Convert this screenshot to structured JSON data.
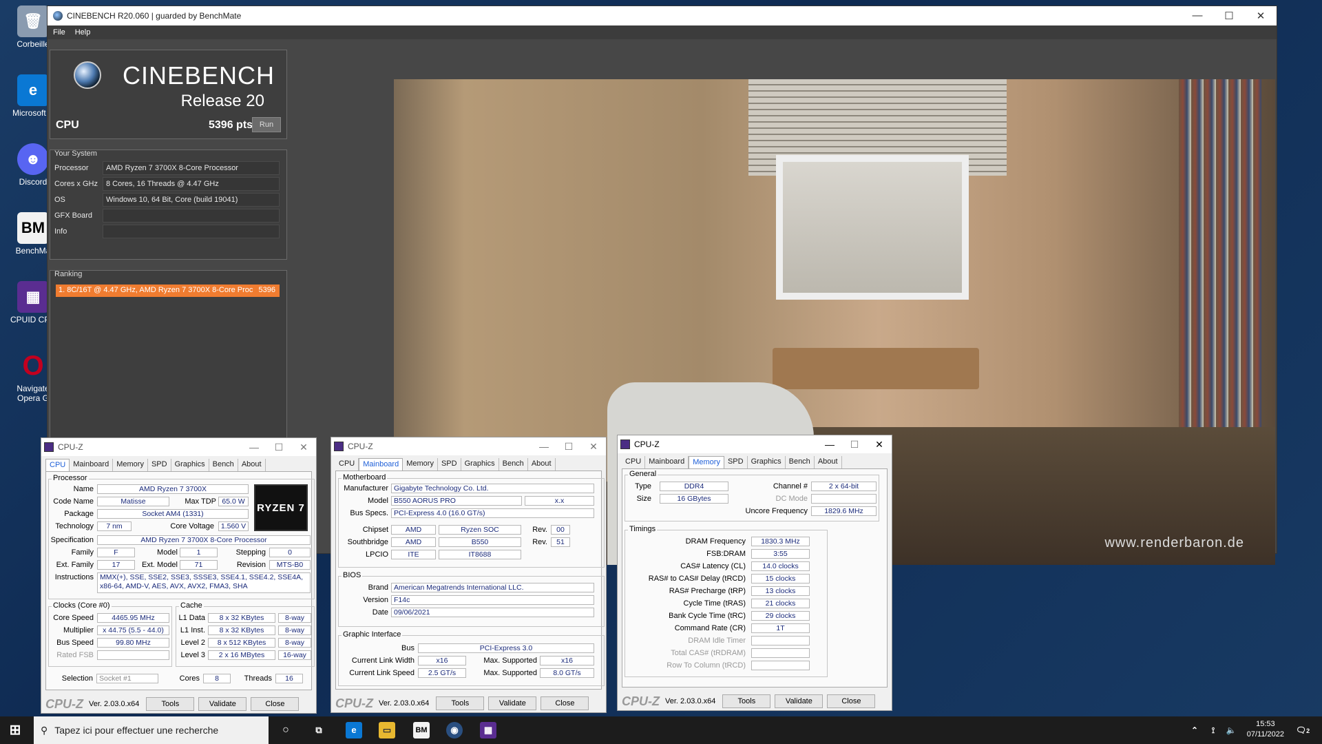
{
  "desktop_icons": [
    {
      "label": "Corbeille",
      "glyph": "🗑",
      "color": "#8a9bb0"
    },
    {
      "label": "Microsoft E",
      "glyph": "e",
      "color": "#0a78d4"
    },
    {
      "label": "Discord",
      "glyph": "☻",
      "color": "#5865f2"
    },
    {
      "label": "BenchMa",
      "glyph": "BM",
      "color": "#f2f2f2"
    },
    {
      "label": "CPUID CPU",
      "glyph": "▦",
      "color": "#5a2d91"
    },
    {
      "label": "Navigate",
      "label2": "Opera G",
      "glyph": "O",
      "color": "#c2001f"
    }
  ],
  "cinebench": {
    "title": "CINEBENCH R20.060 | guarded by BenchMate",
    "menu": [
      "File",
      "Help"
    ],
    "brand": "CINEBENCH",
    "release": "Release 20",
    "cpu_label": "CPU",
    "score": "5396 pts",
    "run": "Run",
    "system_title": "Your System",
    "system": [
      {
        "k": "Processor",
        "v": "AMD Ryzen 7 3700X 8-Core Processor"
      },
      {
        "k": "Cores x GHz",
        "v": "8 Cores, 16 Threads @ 4.47 GHz"
      },
      {
        "k": "OS",
        "v": "Windows 10, 64 Bit, Core (build 19041)"
      },
      {
        "k": "GFX Board",
        "v": ""
      },
      {
        "k": "Info",
        "v": ""
      }
    ],
    "ranking_title": "Ranking",
    "ranking": {
      "entry": "1. 8C/16T @ 4.47 GHz, AMD Ryzen 7 3700X 8-Core Proc",
      "score": "5396"
    },
    "watermark": "www.renderbaron.de"
  },
  "cpuz1": {
    "title": "CPU-Z",
    "tabs": [
      "CPU",
      "Mainboard",
      "Memory",
      "SPD",
      "Graphics",
      "Bench",
      "About"
    ],
    "active": 0,
    "processor": "Processor",
    "name": "AMD Ryzen 7 3700X",
    "maxtdp": "65.0 W",
    "codename": "Matisse",
    "package": "Socket AM4 (1331)",
    "tech": "7 nm",
    "voltage": "1.560 V",
    "spec": "AMD Ryzen 7 3700X 8-Core Processor",
    "family": "F",
    "model": "1",
    "stepping": "0",
    "extfamily": "17",
    "extmodel": "71",
    "revision": "MTS-B0",
    "instr1": "MMX(+), SSE, SSE2, SSE3, SSSE3, SSE4.1, SSE4.2, SSE4A,",
    "instr2": "x86-64, AMD-V, AES, AVX, AVX2, FMA3, SHA",
    "clocks": "Clocks (Core #0)",
    "corespeed": "4465.95 MHz",
    "multiplier": "x 44.75 (5.5 - 44.0)",
    "busspeed": "99.80 MHz",
    "ratedfsb": "",
    "cache": "Cache",
    "l1d": "8 x 32 KBytes",
    "l1dw": "8-way",
    "l1i": "8 x 32 KBytes",
    "l1iw": "8-way",
    "l2": "8 x 512 KBytes",
    "l2w": "8-way",
    "l3": "2 x 16 MBytes",
    "l3w": "16-way",
    "selection": "Socket #1",
    "cores": "8",
    "threads": "16",
    "badge": "RYZEN 7",
    "labels": {
      "name": "Name",
      "maxtdp": "Max TDP",
      "codename": "Code Name",
      "package": "Package",
      "tech": "Technology",
      "voltage": "Core Voltage",
      "spec": "Specification",
      "family": "Family",
      "model": "Model",
      "stepping": "Stepping",
      "extfamily": "Ext. Family",
      "extmodel": "Ext. Model",
      "revision": "Revision",
      "instr": "Instructions",
      "corespeed": "Core Speed",
      "multiplier": "Multiplier",
      "busspeed": "Bus Speed",
      "ratedfsb": "Rated FSB",
      "l1d": "L1 Data",
      "l1i": "L1 Inst.",
      "l2": "Level 2",
      "l3": "Level 3",
      "selection": "Selection",
      "cores": "Cores",
      "threads": "Threads"
    }
  },
  "cpuz2": {
    "title": "CPU-Z",
    "tabs": [
      "CPU",
      "Mainboard",
      "Memory",
      "SPD",
      "Graphics",
      "Bench",
      "About"
    ],
    "active": 1,
    "mb": "Motherboard",
    "manufacturer": "Gigabyte Technology Co. Ltd.",
    "model": "B550 AORUS PRO",
    "model_rev": "x.x",
    "busspecs": "PCI-Express 4.0 (16.0 GT/s)",
    "chipset": "AMD",
    "chipset2": "Ryzen SOC",
    "chipset_rev": "00",
    "south": "AMD",
    "south2": "B550",
    "south_rev": "51",
    "lpcio": "ITE",
    "lpcio2": "IT8688",
    "bios": "BIOS",
    "brand": "American Megatrends International LLC.",
    "version": "F14c",
    "date": "09/06/2021",
    "gi": "Graphic Interface",
    "bus": "PCI-Express 3.0",
    "linkwidth": "x16",
    "maxwidth": "x16",
    "linkspeed": "2.5 GT/s",
    "maxspeed": "8.0 GT/s",
    "labels": {
      "manufacturer": "Manufacturer",
      "model": "Model",
      "busspecs": "Bus Specs.",
      "chipset": "Chipset",
      "south": "Southbridge",
      "lpcio": "LPCIO",
      "rev": "Rev.",
      "brand": "Brand",
      "version": "Version",
      "date": "Date",
      "bus": "Bus",
      "linkwidth": "Current Link Width",
      "linkspeed": "Current Link Speed",
      "maxsup": "Max. Supported"
    }
  },
  "cpuz3": {
    "title": "CPU-Z",
    "tabs": [
      "CPU",
      "Mainboard",
      "Memory",
      "SPD",
      "Graphics",
      "Bench",
      "About"
    ],
    "active": 2,
    "general": "General",
    "type": "DDR4",
    "channels": "2 x 64-bit",
    "size": "16 GBytes",
    "dcmode": "",
    "uncore": "1829.6 MHz",
    "timings": "Timings",
    "dram": "1830.3 MHz",
    "fsb": "3:55",
    "cl": "14.0 clocks",
    "trcd": "15 clocks",
    "trp": "13 clocks",
    "tras": "21 clocks",
    "trc": "29 clocks",
    "cr": "1T",
    "labels": {
      "type": "Type",
      "channels": "Channel #",
      "size": "Size",
      "dcmode": "DC Mode",
      "uncore": "Uncore Frequency",
      "dram": "DRAM Frequency",
      "fsb": "FSB:DRAM",
      "cl": "CAS# Latency (CL)",
      "trcd": "RAS# to CAS# Delay (tRCD)",
      "trp": "RAS# Precharge (tRP)",
      "tras": "Cycle Time (tRAS)",
      "trc": "Bank Cycle Time (tRC)",
      "cr": "Command Rate (CR)",
      "idle": "DRAM Idle Timer",
      "trdram": "Total CAS# (tRDRAM)",
      "rtc": "Row To Column (tRCD)"
    }
  },
  "cpuz_footer": {
    "logo": "CPU-Z",
    "version": "Ver. 2.03.0.x64",
    "tools": "Tools",
    "validate": "Validate",
    "close": "Close"
  },
  "taskbar": {
    "search_placeholder": "Tapez ici pour effectuer une recherche",
    "time": "15:53",
    "date": "07/11/2022",
    "notif": "2"
  }
}
